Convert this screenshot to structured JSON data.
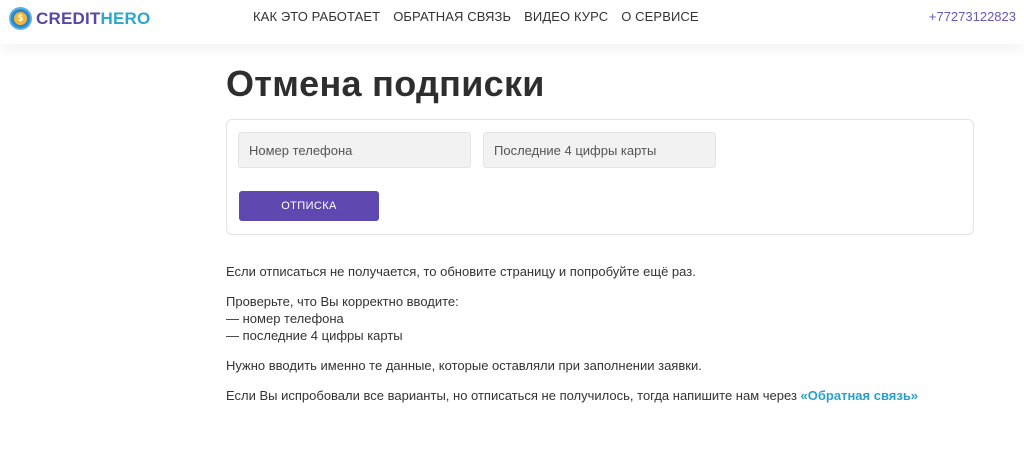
{
  "header": {
    "logo": {
      "part1": "CREDIT",
      "part2": "HERO",
      "badge_symbol": "$"
    },
    "nav": [
      {
        "label": "КАК ЭТО РАБОТАЕТ"
      },
      {
        "label": "ОБРАТНАЯ СВЯЗЬ"
      },
      {
        "label": "ВИДЕО КУРС"
      },
      {
        "label": "О СЕРВИСЕ"
      }
    ],
    "phone": "+77273122823"
  },
  "main": {
    "title": "Отмена подписки",
    "form": {
      "phone_placeholder": "Номер телефона",
      "phone_value": "",
      "card_placeholder": "Последние 4 цифры карты",
      "card_value": "",
      "submit_label": "ОТПИСКА"
    },
    "info": {
      "p1": "Если отписаться не получается, то обновите страницу и попробуйте ещё раз.",
      "p2_line1": "Проверьте, что Вы корректно вводите:",
      "p2_line2": "— номер телефона",
      "p2_line3": "— последние 4 цифры карты",
      "p3": "Нужно вводить именно те данные, которые оставляли при заполнении заявки.",
      "p4_text": "Если Вы испробовали все варианты, но отписаться не получилось, тогда напишите нам через ",
      "p4_link": "«Обратная связь»"
    }
  },
  "colors": {
    "brand_purple": "#5f49b0",
    "brand_blue": "#2aa8d0",
    "link": "#2a9fc9",
    "phone": "#6b57b8"
  }
}
